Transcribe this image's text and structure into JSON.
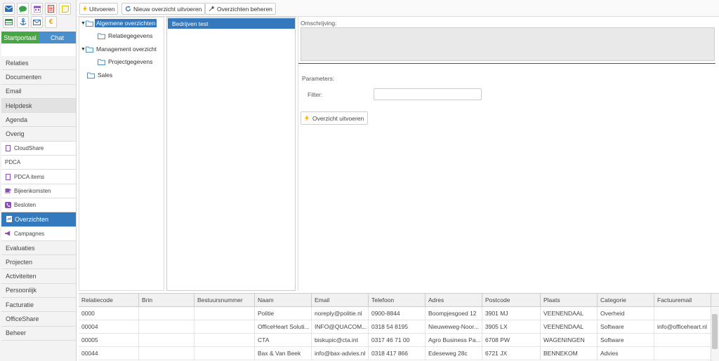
{
  "sidebar": {
    "portal_tab": "Startportaal",
    "chat_tab": "Chat",
    "icons_row1": [
      "mail-icon",
      "chat-bubble-icon",
      "calendar-icon",
      "document-icon",
      "sticky-note-icon"
    ],
    "icons_row2": [
      "table-icon",
      "anchor-icon",
      "envelope-icon",
      "euro-icon"
    ],
    "menu": [
      {
        "label": "Relaties",
        "kind": "main"
      },
      {
        "label": "Documenten",
        "kind": "main"
      },
      {
        "label": "Email",
        "kind": "main"
      },
      {
        "label": "Helpdesk",
        "kind": "highlight"
      },
      {
        "label": "Agenda",
        "kind": "main"
      },
      {
        "label": "Overig",
        "kind": "main"
      },
      {
        "label": "CloudShare",
        "kind": "sub",
        "icon": "file-icon"
      },
      {
        "label": "PDCA",
        "kind": "sub",
        "icon": ""
      },
      {
        "label": "PDCA items",
        "kind": "sub",
        "icon": "file-icon"
      },
      {
        "label": "Bijeenkomsten",
        "kind": "sub",
        "icon": "coffee-cup-icon"
      },
      {
        "label": "Besloten",
        "kind": "sub",
        "icon": "phone-icon"
      },
      {
        "label": "Overzichten",
        "kind": "active",
        "icon": "report-icon"
      },
      {
        "label": "Campagnes",
        "kind": "sub",
        "icon": "megaphone-icon"
      },
      {
        "label": "Evaluaties",
        "kind": "main"
      },
      {
        "label": "Projecten",
        "kind": "main"
      },
      {
        "label": "Activiteiten",
        "kind": "main"
      },
      {
        "label": "Persoonlijk",
        "kind": "main"
      },
      {
        "label": "Facturatie",
        "kind": "main"
      },
      {
        "label": "OfficeShare",
        "kind": "main"
      },
      {
        "label": "Beheer",
        "kind": "main"
      }
    ]
  },
  "toolbar": {
    "run_label": "Uitvoeren",
    "new_label": "Nieuw overzicht uitvoeren",
    "manage_label": "Overzichten beheren"
  },
  "tree": {
    "nodes": [
      {
        "label": "Algemene overzichten",
        "selected": true
      },
      {
        "label": "Relatiegegevens",
        "selected": false
      },
      {
        "label": "Management overzicht",
        "selected": false
      },
      {
        "label": "Projectgegevens",
        "selected": false
      },
      {
        "label": "Sales",
        "selected": false
      }
    ]
  },
  "list": {
    "selected_item": "Bedrijven test"
  },
  "detail": {
    "description_label": "Omschrijving:",
    "parameters_label": "Parameters:",
    "filter_label": "Filter:",
    "filter_value": "",
    "run_button": "Overzicht uitvoeren"
  },
  "grid": {
    "columns": [
      "Relatiecode",
      "Brin",
      "Bestuursnummer",
      "Naam",
      "Email",
      "Telefoon",
      "Adres",
      "Postcode",
      "Plaats",
      "Categorie",
      "Factuuremail"
    ],
    "rows": [
      [
        "0000",
        "",
        "",
        "Politie",
        "noreply@politie.nl",
        "0900-8844",
        "Boompjesgoed 12",
        "3901 MJ",
        "VEENENDAAL",
        "Overheid",
        ""
      ],
      [
        "00004",
        "",
        "",
        "OfficeHeart Soluti...",
        "INFO@QUACOM...",
        "0318 54 8195",
        "Nieuweweg-Noor...",
        "3905 LX",
        "VEENENDAAL",
        "Software",
        "info@officeheart.nl"
      ],
      [
        "00005",
        "",
        "",
        "CTA",
        "biskupic@cta.int",
        "0317 46 71 00",
        "Agro Business Pa...",
        "6708 PW",
        "WAGENINGEN",
        "Software",
        ""
      ],
      [
        "00044",
        "",
        "",
        "Bax & Van Beek",
        "info@bax-advies.nl",
        "0318 417 866",
        "Edeseweg 28c",
        "6721 JX",
        "BENNEKOM",
        "Advies",
        ""
      ]
    ]
  }
}
